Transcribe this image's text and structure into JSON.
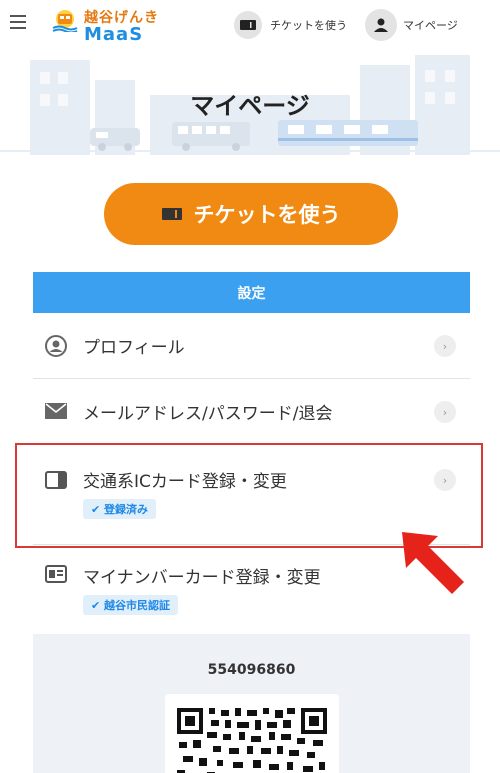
{
  "header": {
    "logo_top": "越谷げんき",
    "logo_bottom": "MaaS",
    "ticket_label": "チケットを使う",
    "mypage_label": "マイページ"
  },
  "banner": {
    "title": "マイページ"
  },
  "ticket_button": {
    "label": "チケットを使う"
  },
  "settings": {
    "title": "設定",
    "items": [
      {
        "label": "プロフィール",
        "icon": "user-icon"
      },
      {
        "label": "メールアドレス/パスワード/退会",
        "icon": "mail-icon"
      },
      {
        "label": "交通系ICカード登録・変更",
        "icon": "ic-card-icon",
        "badge": "✔ 登録済み"
      },
      {
        "label": "マイナンバーカード登録・変更",
        "icon": "id-card-icon",
        "badge": "✔ 越谷市民認証"
      }
    ]
  },
  "qr": {
    "member_id": "554096860"
  },
  "colors": {
    "accent_orange": "#f08a12",
    "accent_blue": "#3aa0ef",
    "highlight_red": "#d83a3a"
  }
}
